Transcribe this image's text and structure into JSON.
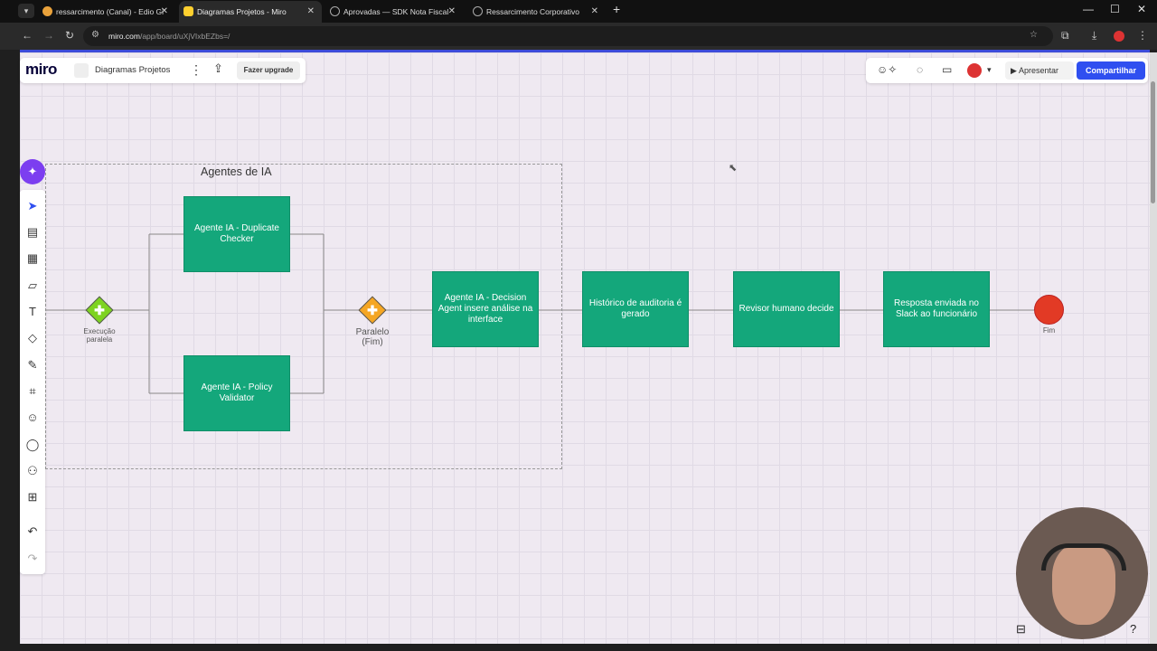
{
  "browser": {
    "tabs": [
      {
        "title": "ressarcimento (Canal) - Edio Gi",
        "color": "#e9a23b"
      },
      {
        "title": "Diagramas Projetos - Miro",
        "color": "#ffd02f"
      },
      {
        "title": "Aprovadas — SDK Nota Fiscal",
        "color": "#888888"
      },
      {
        "title": "Ressarcimento Corporativo",
        "color": "#888888"
      }
    ],
    "url_host": "miro.com",
    "url_path": "/app/board/uXjVIxbEZbs=/"
  },
  "miro": {
    "logo": "miro",
    "board_name": "Diagramas Projetos",
    "upgrade_label": "Fazer upgrade",
    "present_label": "Apresentar",
    "share_label": "Compartilhar"
  },
  "diagram": {
    "frame_title": "Agentes de IA",
    "gateway_start_label": "Execução\nparalela",
    "gateway_end_label": "Paralelo\n(Fim)",
    "boxes": {
      "duplicate": "Agente IA - Duplicate Checker",
      "policy": "Agente IA - Policy Validator",
      "decision": "Agente IA - Decision Agent insere análise na interface",
      "history": "Histórico de auditoria é gerado",
      "reviewer": "Revisor humano decide",
      "response": "Resposta enviada no Slack ao funcionário"
    },
    "end_label": "Fim"
  },
  "colors": {
    "task": "#14a77b",
    "gateway_start": "#7ed321",
    "gateway_end": "#f5a623",
    "end_event": "#e23a25",
    "accent": "#2f4ff0"
  }
}
